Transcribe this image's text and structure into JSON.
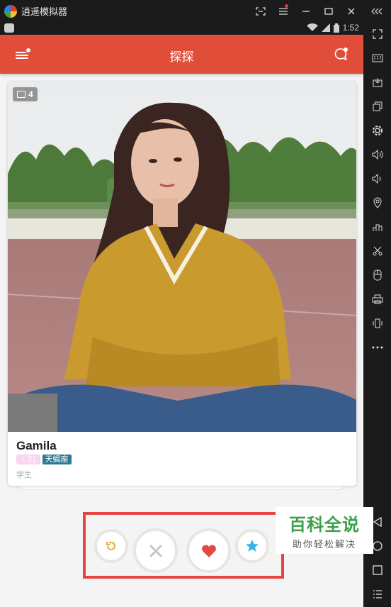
{
  "emulator": {
    "title": "逍遥模拟器",
    "controls": [
      "screenshot-icon",
      "menu-icon",
      "minimize-icon",
      "maximize-icon",
      "close-icon",
      "collapse-icon"
    ],
    "sidebar_icons": [
      "fullscreen-icon",
      "keyboard-icon",
      "apk-icon",
      "multi-window-icon",
      "settings-icon",
      "volume-up-icon",
      "volume-down-icon",
      "location-icon",
      "share-icon",
      "scissors-icon",
      "shake-icon",
      "print-icon",
      "vibrate-icon",
      "more-icon",
      "back-icon",
      "home-icon",
      "recents-icon",
      "list-icon"
    ]
  },
  "status_bar": {
    "time": "1:52"
  },
  "app_bar": {
    "title": "探探"
  },
  "card": {
    "photo_count": "4",
    "name": "Gamila",
    "age": "21",
    "zodiac": "天蝎座",
    "occupation": "学生"
  },
  "actions": [
    "undo-icon",
    "pass-icon",
    "like-icon",
    "superlike-icon"
  ],
  "colors": {
    "brand": "#e04e39",
    "frame": "#e64444",
    "zodiac_tag": "#2b7a92",
    "age_tag": "#f7d6ef"
  },
  "watermark": {
    "main": "百科全说",
    "sub": "助你轻松解决"
  }
}
